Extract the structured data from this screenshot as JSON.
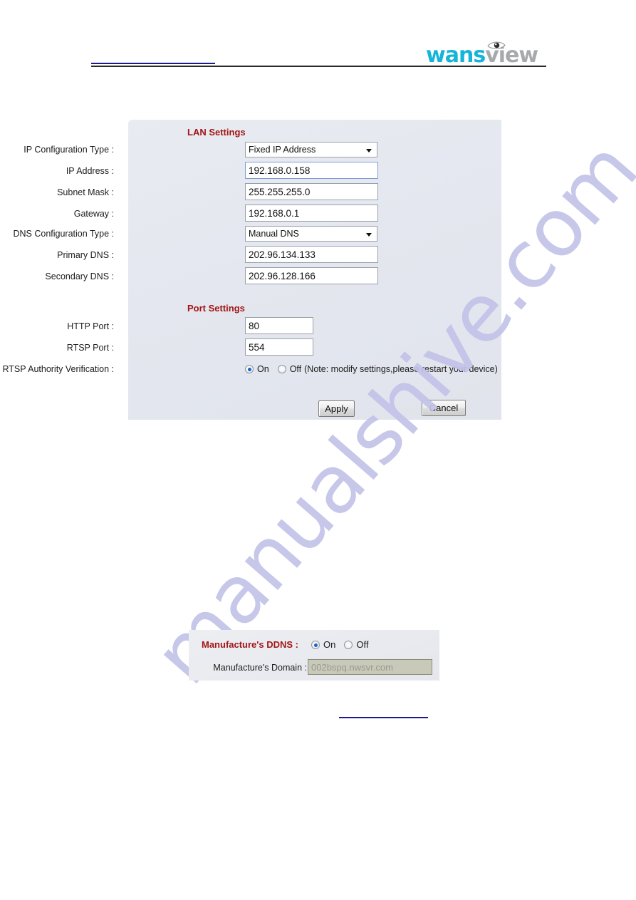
{
  "header": {
    "logo": {
      "brand_part1": "wans",
      "brand_part2": "view",
      "icon": "eye-icon",
      "color_primary": "#13b5d8",
      "color_secondary": "#a7a9ac"
    }
  },
  "watermark": {
    "text": "manualshive.com",
    "color": "#c2c3e8"
  },
  "settings_panel": {
    "lan": {
      "title": "LAN Settings",
      "title_color": "#a31515",
      "fields": [
        {
          "label": "IP Configuration Type :",
          "value": "Fixed IP Address",
          "control": "select"
        },
        {
          "label": "IP Address :",
          "value": "192.168.0.158",
          "control": "text"
        },
        {
          "label": "Subnet Mask :",
          "value": "255.255.255.0",
          "control": "text"
        },
        {
          "label": "Gateway :",
          "value": "192.168.0.1",
          "control": "text"
        },
        {
          "label": "DNS Configuration Type :",
          "value": "Manual DNS",
          "control": "select"
        },
        {
          "label": "Primary DNS :",
          "value": "202.96.134.133",
          "control": "text"
        },
        {
          "label": "Secondary DNS :",
          "value": "202.96.128.166",
          "control": "text"
        }
      ]
    },
    "port": {
      "title": "Port Settings",
      "title_color": "#a31515",
      "fields": [
        {
          "label": "HTTP Port :",
          "value": "80"
        },
        {
          "label": "RTSP Port :",
          "value": "554"
        }
      ],
      "rtsp_auth": {
        "label": "RTSP Authority Verification :",
        "on_label": "On",
        "off_label": "Off",
        "selected": "On",
        "note": "(Note: modify settings,please restart your device)"
      }
    },
    "buttons": {
      "apply": "Apply",
      "cancel": "Cancel"
    }
  },
  "ddns_panel": {
    "ddns_label": "Manufacture's DDNS :",
    "ddns_label_color": "#a31515",
    "on_label": "On",
    "off_label": "Off",
    "selected": "On",
    "domain_label": "Manufacture's Domain :",
    "domain_value": "002bspq.nwsvr.com",
    "domain_disabled": true
  }
}
